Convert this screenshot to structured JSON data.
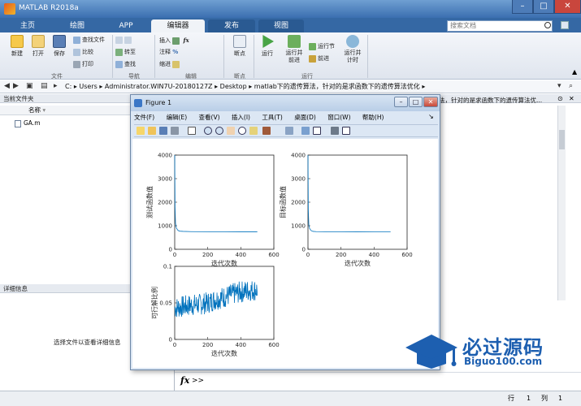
{
  "window": {
    "title": "MATLAB R2018a",
    "min": "–",
    "max": "□",
    "close": "✕"
  },
  "tabs": [
    "主页",
    "绘图",
    "APP",
    "编辑器",
    "发布",
    "视图"
  ],
  "search_placeholder": "搜索文档",
  "ribbon": {
    "file_group": "文件",
    "nav_group": "导航",
    "edit_group": "编辑",
    "bp_group": "断点",
    "run_group": "运行",
    "new": "新建",
    "open": "打开",
    "save": "保存",
    "find_files": "查找文件",
    "compare": "比较",
    "print": "打印",
    "goto": "转至",
    "find": "查找",
    "insert": "插入",
    "comment": "注释",
    "indent": "缩进",
    "breakpoints": "断点",
    "run": "运行",
    "run_advance": "运行并\n前进",
    "run_section": "运行节",
    "advance": "前进",
    "run_time": "运行并\n计时"
  },
  "address": {
    "path": [
      "C:",
      "Users",
      "Administrator.WIN7U-20180127Z",
      "Desktop",
      "matlab下的遗传算法，针对的是求函数下的遗传算法优化"
    ]
  },
  "left_panel": {
    "header": "当前文件夹",
    "col_name": "名称",
    "files": [
      "GA.m"
    ],
    "detail_header": "详细信息",
    "detail_text": "选择文件以查看详细信息"
  },
  "right_panel": {
    "text": "法，针对的是求函数下的遗传算法优..."
  },
  "command": {
    "prompt": ">>"
  },
  "status": {
    "row_label": "行",
    "row": "1",
    "col_label": "列",
    "col": "1"
  },
  "figure": {
    "title": "Figure 1",
    "menu": [
      "文件(F)",
      "编辑(E)",
      "查看(V)",
      "插入(I)",
      "工具(T)",
      "桌面(D)",
      "窗口(W)",
      "帮助(H)"
    ]
  },
  "logo": {
    "main": "必过源码",
    "sub": "Biguo100.com"
  },
  "chart_data": [
    {
      "type": "line",
      "ylabel": "测试函数值",
      "xlabel": "迭代次数",
      "xlim": [
        0,
        600
      ],
      "ylim": [
        0,
        4000
      ],
      "xticks": [
        "0",
        "200",
        "400",
        "600"
      ],
      "yticks": [
        "0",
        "1000",
        "2000",
        "3000",
        "4000"
      ],
      "x": [
        0,
        2,
        5,
        10,
        20,
        30,
        50,
        100,
        200,
        300,
        400,
        500
      ],
      "y": [
        4000,
        1800,
        1100,
        900,
        800,
        770,
        760,
        750,
        745,
        742,
        740,
        740
      ],
      "color": "#0072BD"
    },
    {
      "type": "line",
      "ylabel": "目标函数值",
      "xlabel": "迭代次数",
      "xlim": [
        0,
        600
      ],
      "ylim": [
        0,
        4000
      ],
      "xticks": [
        "0",
        "200",
        "400",
        "600"
      ],
      "yticks": [
        "0",
        "1000",
        "2000",
        "3000",
        "4000"
      ],
      "x": [
        0,
        2,
        5,
        10,
        20,
        30,
        50,
        100,
        200,
        300,
        400,
        500
      ],
      "y": [
        4000,
        1700,
        1050,
        880,
        790,
        760,
        750,
        745,
        742,
        740,
        738,
        738
      ],
      "color": "#0072BD"
    },
    {
      "type": "line",
      "ylabel": "可行解比例",
      "xlabel": "迭代次数",
      "xlim": [
        0,
        600
      ],
      "ylim": [
        0,
        0.1
      ],
      "xticks": [
        "0",
        "200",
        "400",
        "600"
      ],
      "yticks": [
        "0",
        "0.05",
        "0.1"
      ],
      "x": [
        0,
        50,
        100,
        150,
        200,
        250,
        300,
        350,
        400,
        450,
        500
      ],
      "y": [
        0.043,
        0.045,
        0.047,
        0.048,
        0.05,
        0.055,
        0.058,
        0.062,
        0.065,
        0.067,
        0.068
      ],
      "color": "#0072BD"
    }
  ]
}
